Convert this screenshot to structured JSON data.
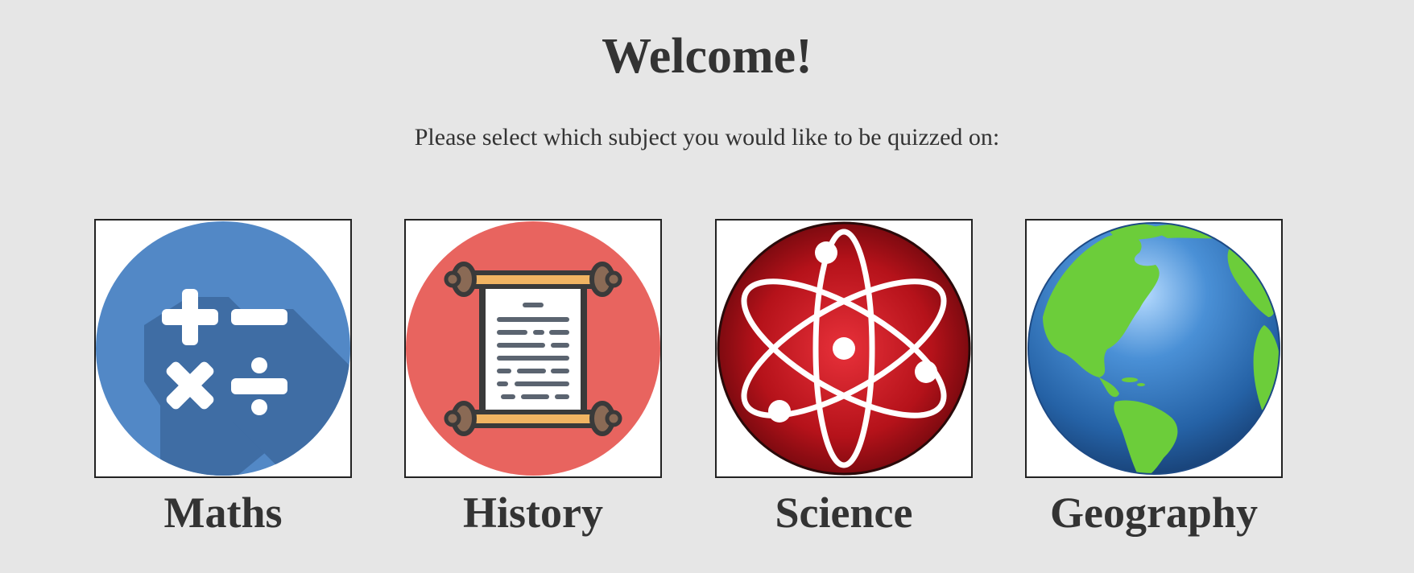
{
  "header": {
    "title": "Welcome!",
    "subtitle": "Please select which subject you would like to be quizzed on:"
  },
  "subjects": [
    {
      "label": "Maths",
      "icon": "math-operators-icon",
      "color": "#5288c6"
    },
    {
      "label": "History",
      "icon": "scroll-icon",
      "color": "#e8645f"
    },
    {
      "label": "Science",
      "icon": "atom-icon",
      "color": "#c0141c"
    },
    {
      "label": "Geography",
      "icon": "globe-icon",
      "color": "#2e6fb3"
    }
  ],
  "colors": {
    "background": "#e6e6e6",
    "text": "#333333"
  }
}
